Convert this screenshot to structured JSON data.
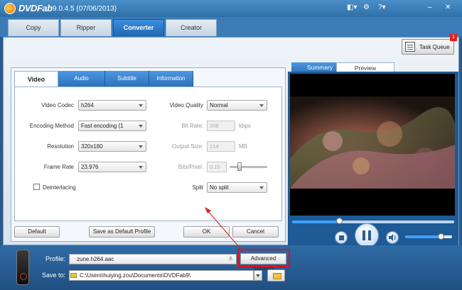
{
  "app": {
    "name": "DVDFab",
    "version": "9.0.4.5 (07/06/2013)"
  },
  "window_controls": {
    "menu": "◧▾",
    "settings": "⚙",
    "help": "?▾",
    "minimize": "–",
    "close": "✕"
  },
  "main_tabs": [
    {
      "label": "Copy"
    },
    {
      "label": "Ripper"
    },
    {
      "label": "Converter",
      "active": true
    },
    {
      "label": "Creator"
    }
  ],
  "task_queue": {
    "label": "Task Queue",
    "badge": "1"
  },
  "settings_tabs": [
    {
      "label": "Video",
      "active": true
    },
    {
      "label": "Audio"
    },
    {
      "label": "Subtitle"
    },
    {
      "label": "Information"
    }
  ],
  "video_settings": {
    "video_codec": {
      "label": "Video Codec",
      "value": "h264"
    },
    "encoding_method": {
      "label": "Encoding Method",
      "value": "Fast encoding (1"
    },
    "resolution": {
      "label": "Resolution",
      "value": "320x180"
    },
    "frame_rate": {
      "label": "Frame Rate",
      "value": "23.976"
    },
    "deinterlacing": {
      "label": "Deinterlacing",
      "checked": false
    },
    "video_quality": {
      "label": "Video Quality",
      "value": "Normal"
    },
    "bit_rate": {
      "label": "Bit Rate:",
      "value": "208",
      "unit": "kbps"
    },
    "output_size": {
      "label": "Output Size:",
      "value": "214",
      "unit": "MB"
    },
    "bits_pixel": {
      "label": "Bits/Pixel:",
      "value": "0.15"
    },
    "split": {
      "label": "Split",
      "value": "No split"
    }
  },
  "buttons": {
    "default": "Default",
    "save_default": "Save as Default Profile",
    "ok": "OK",
    "cancel": "Cancel",
    "advanced": "Advanced Settings"
  },
  "preview_tabs": [
    {
      "label": "Summary"
    },
    {
      "label": "Preview",
      "active": true
    }
  ],
  "playback": {
    "seek_fraction": 0.3,
    "volume_fraction": 0.78
  },
  "profile": {
    "label": "Profile:",
    "value": "zune.h264.aac"
  },
  "save_to": {
    "label": "Save to:",
    "value": "C:\\Users\\huiying.zou\\Documents\\DVDFab9\\"
  },
  "colors": {
    "accent": "#2e72bc",
    "highlight": "#e0101c",
    "title_bar": "#3b7cb8"
  }
}
